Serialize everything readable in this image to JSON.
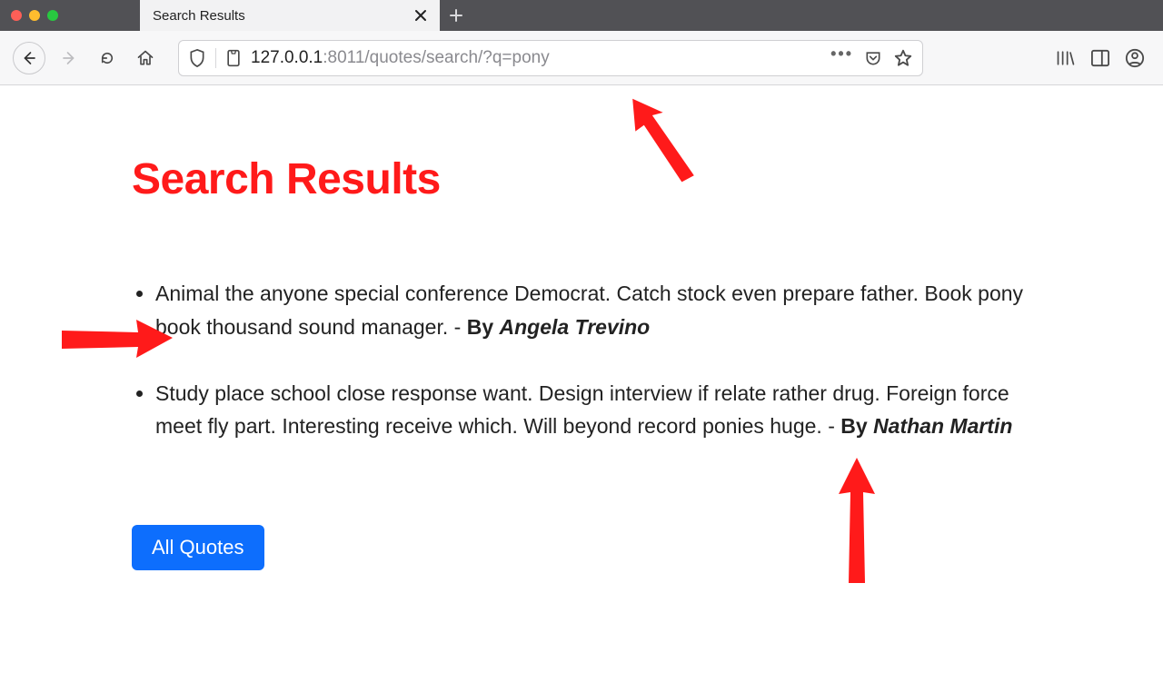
{
  "window": {
    "tab_title": "Search Results"
  },
  "address": {
    "host": "127.0.0.1",
    "port": ":8011",
    "path": "/quotes/search/?q=pony"
  },
  "page": {
    "heading": "Search Results",
    "all_quotes_label": "All Quotes"
  },
  "results": [
    {
      "text": "Animal the anyone special conference Democrat. Catch stock even prepare father. Book pony book thousand sound manager.",
      "by_prefix": " - ",
      "by_label": "By ",
      "author": "Angela Trevino"
    },
    {
      "text": "Study place school close response want. Design interview if relate rather drug. Foreign force meet fly part. Interesting receive which. Will beyond record ponies huge.",
      "by_prefix": " - ",
      "by_label": "By ",
      "author": "Nathan Martin"
    }
  ]
}
